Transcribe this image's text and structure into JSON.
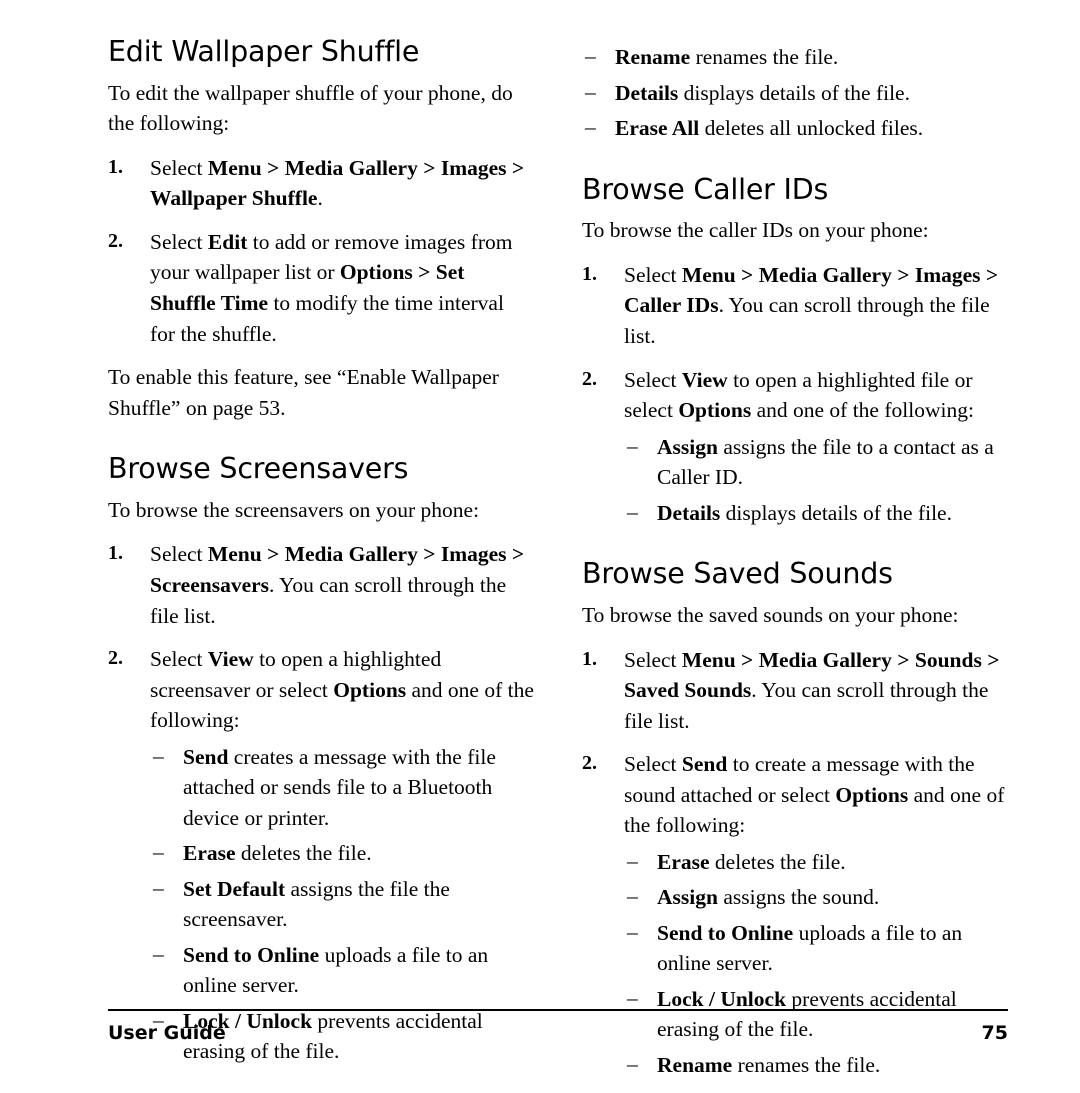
{
  "footer": {
    "left": "User Guide",
    "page": "75"
  },
  "left_column": {
    "section1": {
      "heading": "Edit Wallpaper Shuffle",
      "intro": "To edit the wallpaper shuffle of your phone, do the following:",
      "steps": [
        {
          "num": "1.",
          "parts": [
            {
              "t": "Select ",
              "b": false
            },
            {
              "t": "Menu",
              "b": true
            },
            {
              "t": " > ",
              "b": true
            },
            {
              "t": "Media Gallery",
              "b": true
            },
            {
              "t": " > ",
              "b": true
            },
            {
              "t": "Images",
              "b": true
            },
            {
              "t": " > ",
              "b": true
            },
            {
              "t": "Wallpaper Shuffle",
              "b": true
            },
            {
              "t": ".",
              "b": false
            }
          ]
        },
        {
          "num": "2.",
          "parts": [
            {
              "t": "Select ",
              "b": false
            },
            {
              "t": "Edit",
              "b": true
            },
            {
              "t": " to add or remove images from your wallpaper list or ",
              "b": false
            },
            {
              "t": "Options",
              "b": true
            },
            {
              "t": " > ",
              "b": true
            },
            {
              "t": "Set Shuffle Time",
              "b": true
            },
            {
              "t": " to modify the time interval for the shuffle.",
              "b": false
            }
          ]
        }
      ],
      "note": "To enable this feature, see “Enable Wallpaper Shuffle” on page 53."
    },
    "section2": {
      "heading": "Browse Screensavers",
      "intro": "To browse the screensavers on your phone:",
      "steps": [
        {
          "num": "1.",
          "parts": [
            {
              "t": "Select ",
              "b": false
            },
            {
              "t": "Menu",
              "b": true
            },
            {
              "t": " > ",
              "b": true
            },
            {
              "t": "Media Gallery",
              "b": true
            },
            {
              "t": " > ",
              "b": true
            },
            {
              "t": "Images",
              "b": true
            },
            {
              "t": " > ",
              "b": true
            },
            {
              "t": "Screensavers",
              "b": true
            },
            {
              "t": ". You can scroll through the file list.",
              "b": false
            }
          ]
        },
        {
          "num": "2.",
          "parts": [
            {
              "t": "Select ",
              "b": false
            },
            {
              "t": "View",
              "b": true
            },
            {
              "t": " to open a highlighted screensaver or select ",
              "b": false
            },
            {
              "t": "Options",
              "b": true
            },
            {
              "t": " and one of the following:",
              "b": false
            }
          ]
        }
      ],
      "sub_items": [
        [
          {
            "t": "Send",
            "b": true
          },
          {
            "t": " creates a message with the file attached or sends file to a Bluetooth device or printer.",
            "b": false
          }
        ],
        [
          {
            "t": "Erase",
            "b": true
          },
          {
            "t": " deletes the file.",
            "b": false
          }
        ],
        [
          {
            "t": "Set Default",
            "b": true
          },
          {
            "t": " assigns the file the screensaver.",
            "b": false
          }
        ],
        [
          {
            "t": "Send to Online",
            "b": true
          },
          {
            "t": " uploads a file to an online server.",
            "b": false
          }
        ],
        [
          {
            "t": "Lock / Unlock",
            "b": true
          },
          {
            "t": " prevents accidental erasing of the file.",
            "b": false
          }
        ]
      ]
    }
  },
  "right_column": {
    "top_items": [
      [
        {
          "t": "Rename",
          "b": true
        },
        {
          "t": " renames the file.",
          "b": false
        }
      ],
      [
        {
          "t": "Details",
          "b": true
        },
        {
          "t": " displays details of the file.",
          "b": false
        }
      ],
      [
        {
          "t": "Erase All",
          "b": true
        },
        {
          "t": " deletes all unlocked files.",
          "b": false
        }
      ]
    ],
    "section1": {
      "heading": "Browse Caller IDs",
      "intro": "To browse the caller IDs on your phone:",
      "steps": [
        {
          "num": "1.",
          "parts": [
            {
              "t": "Select ",
              "b": false
            },
            {
              "t": "Menu",
              "b": true
            },
            {
              "t": " > ",
              "b": true
            },
            {
              "t": "Media Gallery",
              "b": true
            },
            {
              "t": " > ",
              "b": true
            },
            {
              "t": "Images",
              "b": true
            },
            {
              "t": " > ",
              "b": true
            },
            {
              "t": "Caller IDs",
              "b": true
            },
            {
              "t": ". You can scroll through the file list.",
              "b": false
            }
          ]
        },
        {
          "num": "2.",
          "parts": [
            {
              "t": "Select ",
              "b": false
            },
            {
              "t": "View",
              "b": true
            },
            {
              "t": " to open a highlighted file or select ",
              "b": false
            },
            {
              "t": "Options",
              "b": true
            },
            {
              "t": " and one of the following:",
              "b": false
            }
          ]
        }
      ],
      "sub_items": [
        [
          {
            "t": "Assign",
            "b": true
          },
          {
            "t": " assigns the file to a contact as a Caller ID.",
            "b": false
          }
        ],
        [
          {
            "t": "Details",
            "b": true
          },
          {
            "t": " displays details of the file.",
            "b": false
          }
        ]
      ]
    },
    "section2": {
      "heading": "Browse Saved Sounds",
      "intro": "To browse the saved sounds on your phone:",
      "steps": [
        {
          "num": "1.",
          "parts": [
            {
              "t": "Select ",
              "b": false
            },
            {
              "t": "Menu",
              "b": true
            },
            {
              "t": " > ",
              "b": true
            },
            {
              "t": "Media Gallery",
              "b": true
            },
            {
              "t": " > ",
              "b": true
            },
            {
              "t": "Sounds",
              "b": true
            },
            {
              "t": " > ",
              "b": true
            },
            {
              "t": "Saved Sounds",
              "b": true
            },
            {
              "t": ". You can scroll through the file list.",
              "b": false
            }
          ]
        },
        {
          "num": "2.",
          "parts": [
            {
              "t": "Select ",
              "b": false
            },
            {
              "t": "Send",
              "b": true
            },
            {
              "t": " to create a message with the sound attached or select ",
              "b": false
            },
            {
              "t": "Options",
              "b": true
            },
            {
              "t": " and one of the following:",
              "b": false
            }
          ]
        }
      ],
      "sub_items": [
        [
          {
            "t": "Erase",
            "b": true
          },
          {
            "t": " deletes the file.",
            "b": false
          }
        ],
        [
          {
            "t": "Assign",
            "b": true
          },
          {
            "t": " assigns the sound.",
            "b": false
          }
        ],
        [
          {
            "t": "Send to Online",
            "b": true
          },
          {
            "t": " uploads a file to an online server.",
            "b": false
          }
        ],
        [
          {
            "t": "Lock / Unlock",
            "b": true
          },
          {
            "t": " prevents accidental erasing of the file.",
            "b": false
          }
        ],
        [
          {
            "t": "Rename",
            "b": true
          },
          {
            "t": " renames the file.",
            "b": false
          }
        ]
      ]
    }
  },
  "icons": {
    "dash": "–"
  }
}
